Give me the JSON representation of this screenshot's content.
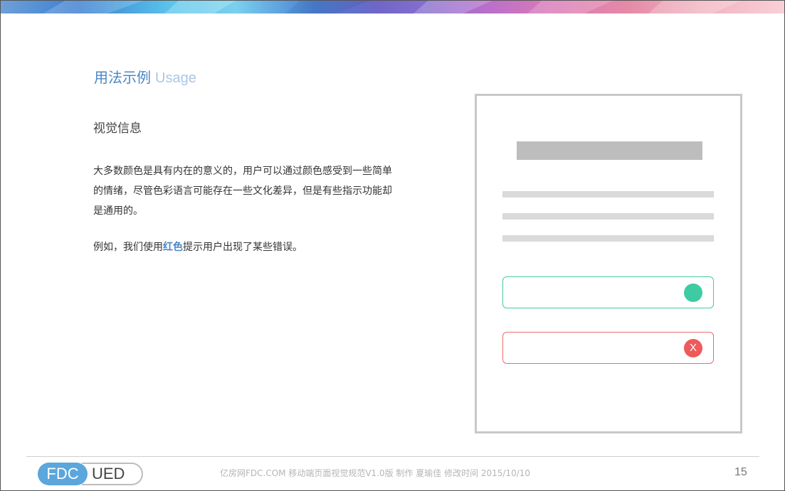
{
  "slide": {
    "title_zh": "用法示例",
    "title_en": "Usage",
    "sub_heading": "视觉信息",
    "body": "大多数颜色是具有内在的意义的，用户可以通过颜色感受到一些简单的情绪，尽管色彩语言可能存在一些文化差异，但是有些指示功能却是通用的。",
    "example_prefix": "例如，我们使用",
    "example_highlight": "红色",
    "example_suffix": "提示用户出现了某些错误。",
    "highlight_color": "#4a86c6"
  },
  "mockup": {
    "success_color": "#3ecba3",
    "error_color": "#ef5a5a",
    "error_icon_text": "X",
    "success_icon": "circle-dot-icon",
    "error_icon": "x-circle-icon"
  },
  "footer": {
    "logo_left": "FDC",
    "logo_right": "UED",
    "text": "亿房网FDC.COM 移动端页面视觉规范V1.0版   制作 夏瑜佳     修改时间   2015/10/10",
    "page_number": "15"
  }
}
